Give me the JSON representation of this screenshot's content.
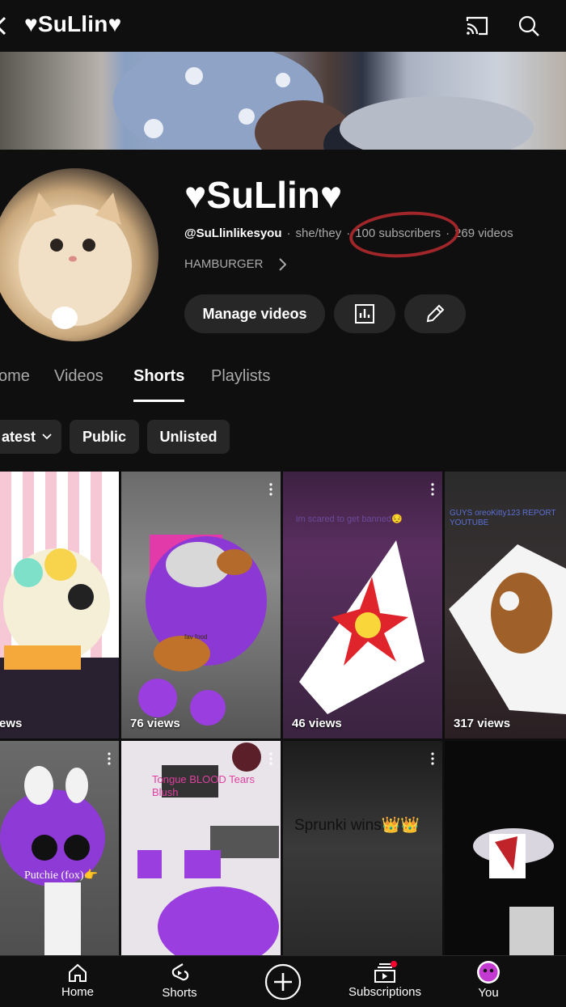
{
  "topbar": {
    "title": "♥SuLlin♥",
    "icons": [
      "back-arrow-icon",
      "cast-icon",
      "search-icon"
    ]
  },
  "channel": {
    "name": "♥SuLlin♥",
    "handle": "@SuLlinlikesyou",
    "pronouns": "she/they",
    "subscribers": "100 subscribers",
    "videos": "269 videos",
    "link_text": "HAMBURGER",
    "annotation_color": "#a0262a"
  },
  "actions": {
    "manage_label": "Manage videos",
    "analytics_icon": "analytics-icon",
    "edit_icon": "pencil-icon"
  },
  "tabs": [
    {
      "label": "ome"
    },
    {
      "label": "Videos"
    },
    {
      "label": "Shorts",
      "active": true
    },
    {
      "label": "Playlists"
    }
  ],
  "filters": [
    {
      "label": "atest"
    },
    {
      "label": "Public"
    },
    {
      "label": "Unlisted"
    }
  ],
  "shorts": [
    {
      "views": "ews",
      "overlay": ""
    },
    {
      "views": "76 views",
      "overlay": "fav food"
    },
    {
      "views": "46 views",
      "overlay": "im scared to get banned😔"
    },
    {
      "views": "317 views",
      "overlay": "GUYS oreoKitty123 REPORT YOUTUBE"
    },
    {
      "views": "",
      "overlay": "Putchie (fox)👉"
    },
    {
      "views": "",
      "overlay": "Tongue BLOOD Tears Blush"
    },
    {
      "views": "",
      "overlay": "Sprunki wins👑👑"
    },
    {
      "views": "",
      "overlay": ""
    }
  ],
  "bottom_nav": [
    {
      "label": "Home",
      "icon": "home-icon"
    },
    {
      "label": "Shorts",
      "icon": "shorts-icon"
    },
    {
      "label": "",
      "icon": "create-icon"
    },
    {
      "label": "Subscriptions",
      "icon": "subscriptions-icon"
    },
    {
      "label": "You",
      "icon": "you-avatar-icon"
    }
  ],
  "colors": {
    "background": "#0f0f0f",
    "chip": "#272727",
    "secondary_text": "#aaaaaa",
    "notification_dot": "#ff0033"
  }
}
